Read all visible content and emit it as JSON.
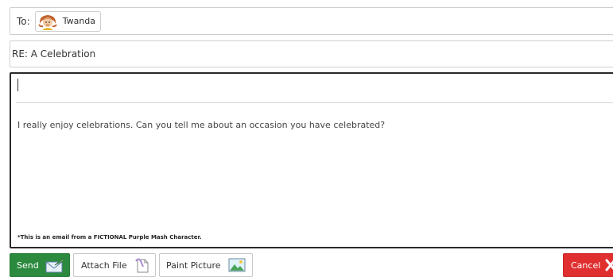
{
  "compose": {
    "to": {
      "label": "To:",
      "recipient": "Twanda",
      "avatar_icon": "girl-avatar-icon"
    },
    "subject": "RE: A Celebration",
    "body": {
      "reply_value": "",
      "quoted_text": "I really enjoy celebrations. Can you tell me about an occasion you have celebrated?",
      "disclaimer": "*This is an email from a FICTIONAL Purple Mash Character."
    }
  },
  "actions": {
    "send": {
      "label": "Send",
      "icon": "send-envelope-icon"
    },
    "attach": {
      "label": "Attach File",
      "icon": "paperclip-document-icon"
    },
    "paint": {
      "label": "Paint Picture",
      "icon": "picture-icon"
    },
    "cancel": {
      "label": "Cancel",
      "icon": "close-icon"
    }
  },
  "colors": {
    "send": "#2c8a3e",
    "cancel": "#e02f2f",
    "border": "#cfcfcf",
    "body_border": "#2a2a2a"
  }
}
